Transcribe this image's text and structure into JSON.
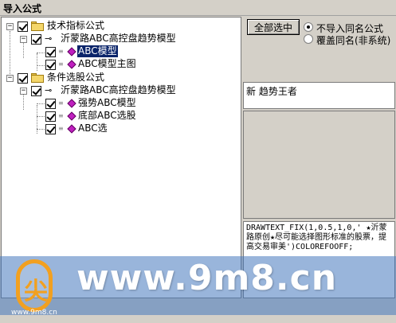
{
  "window": {
    "title": "导入公式"
  },
  "tree": {
    "group1": {
      "label": "技术指标公式",
      "child": {
        "label": "沂蒙路ABC高控盘趋势模型",
        "items": [
          "ABC模型",
          "ABC模型主图"
        ]
      }
    },
    "group2": {
      "label": "条件选股公式",
      "child": {
        "label": "沂蒙路ABC高控盘趋势模型",
        "items": [
          "强势ABC模型",
          "底部ABC选股",
          "ABC选"
        ]
      }
    }
  },
  "actions": {
    "select_all": "全部选中"
  },
  "options": {
    "no_import_same_name": "不导入同名公式",
    "overwrite_same_name": "覆盖同名(非系统)",
    "selected": "no_import_same_name"
  },
  "formula": {
    "name": "新 趋势王者",
    "code": "DRAWTEXT_FIX(1,0.5,1,0,' ★沂蒙路原创★尽可能选择图形标准的股票，提高交易审美')COLOREFOOFF;"
  },
  "watermark": {
    "url": "www.9m8.cn",
    "small": "www.9m8.cn",
    "logo_glyph": "尖"
  },
  "colors": {
    "selection": "#0a246a",
    "formula_icon": "#c020c0",
    "folder": "#f4d66a",
    "watermark_band": "#4678be",
    "watermark_logo": "#f2a020"
  },
  "icons": {
    "folder": "folder-icon",
    "formula_set": "key-icon",
    "formula": "diamond-icon",
    "expand": "minus-expander-icon"
  }
}
